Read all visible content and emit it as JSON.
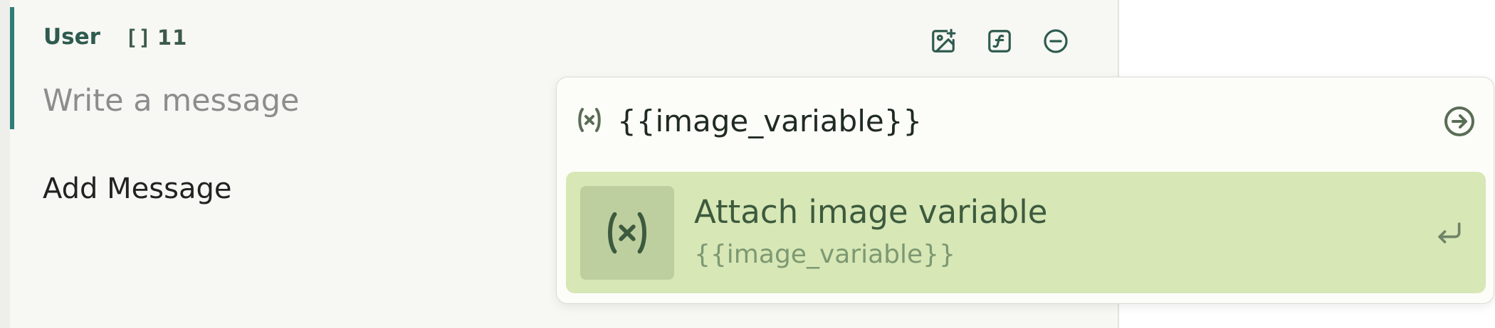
{
  "message": {
    "role": "User",
    "token_badge_icon": "[]",
    "token_count": "11",
    "input_placeholder": "Write a message",
    "toolbar": {
      "icons": [
        "add-image-icon",
        "function-icon",
        "remove-circle-icon"
      ]
    }
  },
  "add_message_label": "Add Message",
  "variable_popover": {
    "input_value": "{{image_variable}}",
    "leading_icon": "variable-icon",
    "submit_icon": "arrow-right-circle-icon",
    "suggestion": {
      "title": "Attach image variable",
      "subtitle": "{{image_variable}}",
      "icon": "variable-icon",
      "key_hint_icon": "enter-key-icon"
    }
  },
  "colors": {
    "accent": "#2f7d76",
    "suggestion_bg": "#d7e7b5",
    "role_text": "#2e5b4f"
  }
}
